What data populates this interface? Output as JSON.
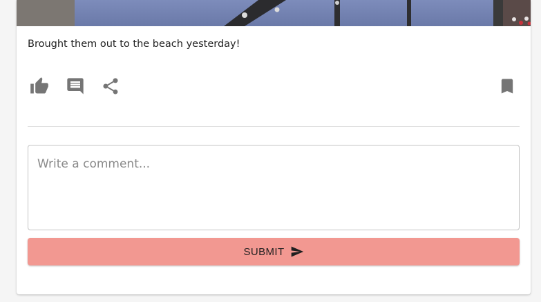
{
  "post": {
    "caption": "Brought them out to the beach yesterday!",
    "image_alt_icon": "post-photo"
  },
  "actions": {
    "like_icon": "thumb-up-icon",
    "comment_icon": "comment-icon",
    "share_icon": "share-icon",
    "bookmark_icon": "bookmark-icon",
    "icon_color": "#757575"
  },
  "comment_form": {
    "placeholder": "Write a comment...",
    "value": "",
    "submit_label": "SUBMIT",
    "submit_icon": "send-icon",
    "submit_color": "#f29891"
  }
}
